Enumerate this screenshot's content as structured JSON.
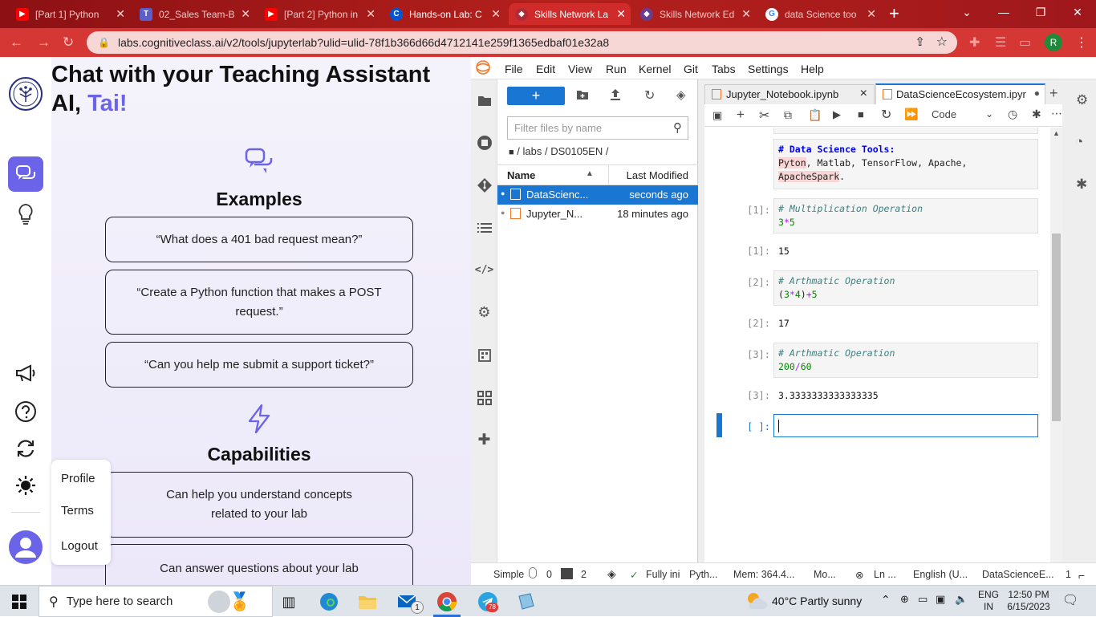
{
  "browser": {
    "tabs": [
      {
        "label": "[Part 1] Python",
        "fav": "youtube-icon",
        "color": "#ff0000"
      },
      {
        "label": "02_Sales Team-B",
        "fav": "teams-icon",
        "color": "#5b5fc7"
      },
      {
        "label": "[Part 2] Python in",
        "fav": "youtube-icon",
        "color": "#ff0000"
      },
      {
        "label": "Hands-on Lab: C",
        "fav": "coursera-icon",
        "color": "#0056d2"
      },
      {
        "label": "Skills Network La",
        "fav": "skills-network-icon",
        "color": "#b02a37"
      },
      {
        "label": "Skills Network Ed",
        "fav": "skills-network-ed-icon",
        "color": "#6a3d8f"
      },
      {
        "label": "data Science too",
        "fav": "google-icon",
        "color": "#4285f4"
      }
    ],
    "new_tab": "+",
    "url": "labs.cognitiveclass.ai/v2/tools/jupyterlab?ulid=ulid-78f1b366d66d4712141e259f1365edbaf01e32a8",
    "profile_initial": "R"
  },
  "chat": {
    "title_line1": "Chat with your Teaching Assistant",
    "title_line2_prefix": "AI, ",
    "title_line2_accent": "Tai!",
    "accent_color": "#6b63e8",
    "examples_heading": "Examples",
    "examples": [
      "“What does a 401 bad request mean?”",
      "“Create a Python function that makes a POST request.”",
      "“Can you help me submit a support ticket?”"
    ],
    "capabilities_heading": "Capabilities",
    "capabilities": [
      "Can help you understand concepts related to your lab",
      "Can answer questions about your lab"
    ],
    "menu": {
      "profile": "Profile",
      "terms": "Terms",
      "logout": "Logout"
    }
  },
  "jupyter": {
    "menus": [
      "File",
      "Edit",
      "View",
      "Run",
      "Kernel",
      "Git",
      "Tabs",
      "Settings",
      "Help"
    ],
    "new_button": "+",
    "filter_placeholder": "Filter files by name",
    "breadcrumb": "/ labs / DS0105EN /",
    "columns": {
      "name": "Name",
      "modified": "Last Modified"
    },
    "files": [
      {
        "name": "DataScienc...",
        "modified": "seconds ago",
        "selected": true
      },
      {
        "name": "Jupyter_N...",
        "modified": "18 minutes ago",
        "selected": false
      }
    ],
    "doc_tabs": [
      {
        "label": "Jupyter_Notebook.ipynb",
        "close": "×"
      },
      {
        "label": "DataScienceEcosystem.ipyr",
        "close": "●"
      }
    ],
    "cell_type": "Code",
    "markdown_cell": {
      "heading": "# Data Science Tools:",
      "line1": [
        "Pyton",
        ", Matlab, TensorFlow, Apache,"
      ],
      "line2": [
        "ApacheSpark",
        "."
      ]
    },
    "cells": [
      {
        "in_prompt": "[1]:",
        "comment": "# Multiplication Operation",
        "code": [
          "3",
          "*",
          "5"
        ],
        "out_prompt": "[1]:",
        "output": "15"
      },
      {
        "in_prompt": "[2]:",
        "comment": "# Arthmatic Operation",
        "code": [
          "(",
          "3",
          "*",
          "4",
          ")",
          "+",
          "5"
        ],
        "out_prompt": "[2]:",
        "output": "17"
      },
      {
        "in_prompt": "[3]:",
        "comment": "# Arthmatic Operation",
        "code": [
          "200",
          "/",
          "60"
        ],
        "out_prompt": "[3]:",
        "output": "3.3333333333333335"
      }
    ],
    "empty_prompt": "[ ]:",
    "status": {
      "mode": "Simple",
      "count0": "0",
      "count2": "2",
      "git": "Fully ini",
      "kernel": "Pyth...",
      "mem": "Mem: 364.4...",
      "mo": "Mo...",
      "ln": "Ln ...",
      "lang": "English (U...",
      "doc": "DataScienceE...",
      "one": "1"
    }
  },
  "taskbar": {
    "search_placeholder": "Type here to search",
    "weather": "40°C  Partly sunny",
    "lang1": "ENG",
    "lang2": "IN",
    "time": "12:50 PM",
    "date": "6/15/2023",
    "mail_badge": "1",
    "telegram_badge": "78"
  }
}
